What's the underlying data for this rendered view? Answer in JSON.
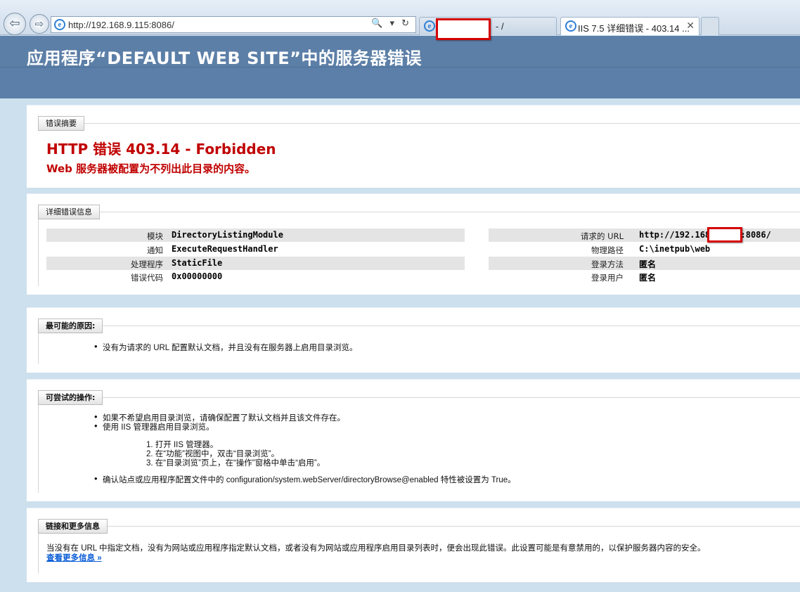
{
  "browser": {
    "address": "http://192.168.9.115:8086/",
    "address_tools": "🔍 ▾ ↻",
    "tab1_title": "- /",
    "tab2_title": "IIS 7.5 详细错误 - 403.14 ...",
    "tab_close": "✕",
    "back": "⇦",
    "forward": "⇨"
  },
  "header": {
    "title": "应用程序“DEFAULT WEB SITE”中的服务器错误"
  },
  "summary": {
    "legend": "错误摘要",
    "error_title": "HTTP 错误 403.14 - Forbidden",
    "error_desc": "Web 服务器被配置为不列出此目录的内容。"
  },
  "detail": {
    "legend": "详细错误信息",
    "left": [
      {
        "key": "模块",
        "value": "DirectoryListingModule"
      },
      {
        "key": "通知",
        "value": "ExecuteRequestHandler"
      },
      {
        "key": "处理程序",
        "value": "StaticFile"
      },
      {
        "key": "错误代码",
        "value": "0x00000000"
      }
    ],
    "right": [
      {
        "key": "请求的 URL",
        "value": "http://192.168.9.115:8086/"
      },
      {
        "key": "物理路径",
        "value": "C:\\inetpub\\web"
      },
      {
        "key": "登录方法",
        "value": "匿名"
      },
      {
        "key": "登录用户",
        "value": "匿名"
      }
    ]
  },
  "cause": {
    "legend": "最可能的原因:",
    "items": [
      "没有为请求的 URL 配置默认文档，并且没有在服务器上启用目录浏览。"
    ]
  },
  "action": {
    "legend": "可尝试的操作:",
    "items": [
      "如果不希望启用目录浏览，请确保配置了默认文档并且该文件存在。",
      "使用 IIS 管理器启用目录浏览。"
    ],
    "steps": [
      "1.  打开 IIS 管理器。",
      "2.  在“功能”视图中，双击“目录浏览”。",
      "3.  在“目录浏览”页上，在“操作”窗格中单击“启用”。"
    ],
    "last_item": "确认站点或应用程序配置文件中的 configuration/system.webServer/directoryBrowse@enabled 特性被设置为 True。"
  },
  "links": {
    "legend": "链接和更多信息",
    "text": "当没有在 URL 中指定文档，没有为网站或应用程序指定默认文档，或者没有为网站或应用程序启用目录列表时，便会出现此错误。此设置可能是有意禁用的，以保护服务器内容的安全。",
    "more_link": "查看更多信息 »"
  }
}
